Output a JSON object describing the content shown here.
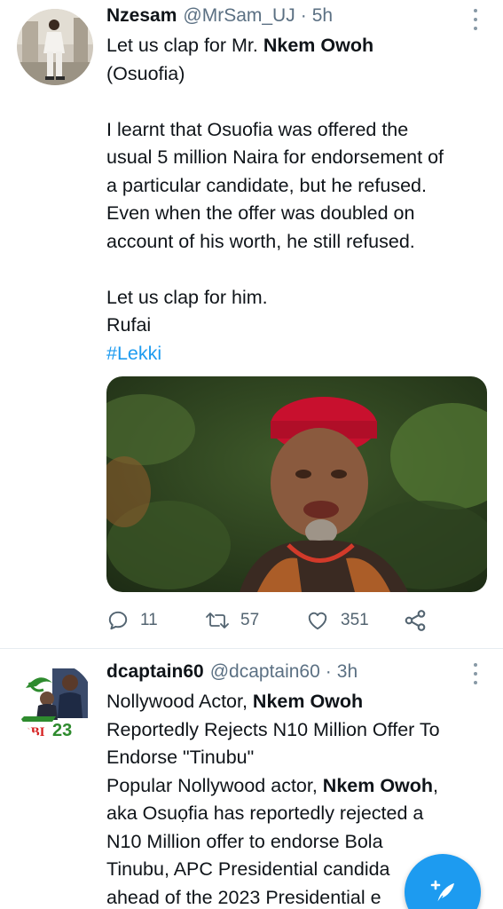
{
  "tweets": [
    {
      "author_name": "Nzesam",
      "handle": "@MrSam_UJ",
      "separator": "·",
      "time": "5h",
      "text_lines": [
        {
          "parts": [
            {
              "t": "Let us clap for Mr. "
            },
            {
              "t": "Nkem Owoh",
              "bold": true
            }
          ]
        },
        {
          "parts": [
            {
              "t": "(Osuofia)"
            }
          ]
        },
        {
          "blank": true
        },
        {
          "parts": [
            {
              "t": "I learnt that Osuofia was offered the"
            }
          ]
        },
        {
          "parts": [
            {
              "t": "usual 5 million Naira for  endorsement of"
            }
          ]
        },
        {
          "parts": [
            {
              "t": "a particular candidate,  but he refused."
            }
          ]
        },
        {
          "parts": [
            {
              "t": "Even when the offer was doubled on"
            }
          ]
        },
        {
          "parts": [
            {
              "t": "account of his worth, he still refused."
            }
          ]
        },
        {
          "blank": true
        },
        {
          "parts": [
            {
              "t": "Let us clap for him."
            }
          ]
        },
        {
          "parts": [
            {
              "t": "Rufai"
            }
          ]
        },
        {
          "parts": [
            {
              "t": "#Lekki",
              "link": true
            }
          ]
        }
      ],
      "actions": {
        "replies": "11",
        "retweets": "57",
        "likes": "351"
      }
    },
    {
      "author_name": "dcaptain60",
      "handle": "@dcaptain60",
      "separator": "·",
      "time": "3h",
      "avatar_text": "OBI 23",
      "text_lines": [
        {
          "parts": [
            {
              "t": "Nollywood Actor, "
            },
            {
              "t": "Nkem Owoh",
              "bold": true
            }
          ]
        },
        {
          "parts": [
            {
              "t": "Reportedly Rejects N10 Million Offer To"
            }
          ]
        },
        {
          "parts": [
            {
              "t": "Endorse \"Tinubu\""
            }
          ]
        },
        {
          "parts": [
            {
              "t": "Popular Nollywood actor, "
            },
            {
              "t": "Nkem Owoh",
              "bold": true
            },
            {
              "t": ","
            }
          ]
        },
        {
          "parts": [
            {
              "t": "aka Osuọfia has reportedly rejected a"
            }
          ]
        },
        {
          "parts": [
            {
              "t": "N10 Million offer to endorse Bola"
            }
          ]
        },
        {
          "parts": [
            {
              "t": "Tinubu, APC Presidential candida"
            }
          ]
        },
        {
          "parts": [
            {
              "t": "ahead of the 2023 Presidential e"
            }
          ]
        }
      ]
    }
  ],
  "icons": {
    "reply": "reply-icon",
    "retweet": "retweet-icon",
    "like": "heart-icon",
    "share": "share-icon",
    "more": "more-icon",
    "compose": "compose-tweet-icon"
  },
  "colors": {
    "accent": "#1d9bf0",
    "secondary_text": "#5b7083",
    "divider": "#e6ecf0"
  }
}
